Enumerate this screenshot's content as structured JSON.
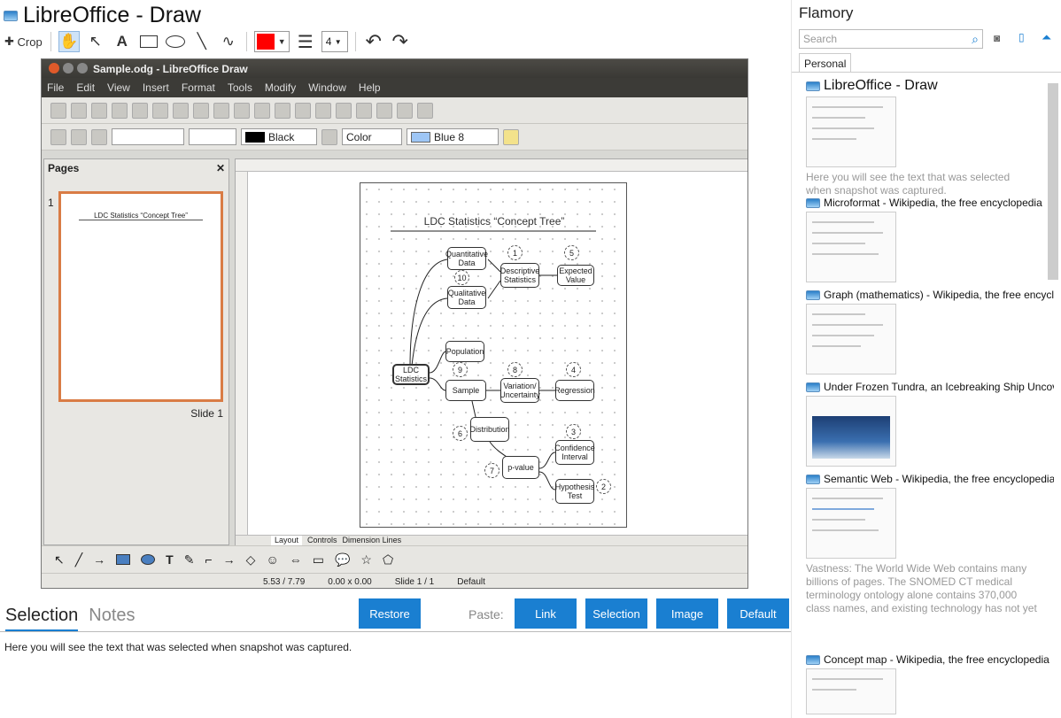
{
  "header": {
    "title": "LibreOffice - Draw",
    "crop_label": "Crop",
    "line_width": "4"
  },
  "lo": {
    "window_title": "Sample.odg - LibreOffice Draw",
    "menu": [
      "File",
      "Edit",
      "View",
      "Insert",
      "Format",
      "Tools",
      "Modify",
      "Window",
      "Help"
    ],
    "line_color": "Black",
    "fill_type": "Color",
    "fill_color": "Blue 8",
    "pages_title": "Pages",
    "page_number": "1",
    "slide_label": "Slide 1",
    "tabs": [
      "Layout",
      "Controls",
      "Dimension Lines"
    ],
    "status": {
      "position": "5.53 / 7.79",
      "size": "0.00 x 0.00",
      "slide": "Slide 1 / 1",
      "master": "Default"
    },
    "diagram": {
      "title": "LDC Statistics “Concept Tree”",
      "nodes": [
        "LDC Statistics",
        "Quantitative Data",
        "Qualitative Data",
        "Descriptive Statistics",
        "Expected Value",
        "Population",
        "Sample",
        "Variation/ Uncertainty",
        "Regression",
        "Distribution",
        "Confidence Interval",
        "p-value",
        "Hypothesis Test"
      ],
      "numbers": [
        "1",
        "5",
        "10",
        "9",
        "8",
        "4",
        "6",
        "3",
        "7",
        "2"
      ]
    }
  },
  "bottom": {
    "tab_selection": "Selection",
    "tab_notes": "Notes",
    "restore": "Restore",
    "paste_label": "Paste:",
    "paste_buttons": [
      "Link",
      "Selection",
      "Image",
      "Default"
    ],
    "selection_text": "Here you will see the text that was selected when snapshot was captured."
  },
  "side": {
    "app_name": "Flamory",
    "search_placeholder": "Search",
    "tab": "Personal",
    "items": [
      {
        "title": "LibreOffice - Draw",
        "desc": "Here you will see the text that was selected when snapshot was captured."
      },
      {
        "title": "Microformat - Wikipedia, the free encyclopedia"
      },
      {
        "title": "Graph (mathematics) - Wikipedia, the free encyclopedia"
      },
      {
        "title": "Under Frozen Tundra, an Icebreaking Ship Uncovers"
      },
      {
        "title": "Semantic Web - Wikipedia, the free encyclopedia",
        "desc": "Vastness: The World Wide Web contains many billions of pages. The SNOMED CT medical terminology ontology alone contains 370,000 class names, and existing technology has not yet been able to eliminate all semantically duplicated terms. Any automated reasoning system will have to deal with truly huge inputs."
      },
      {
        "title": "Concept map - Wikipedia, the free encyclopedia"
      }
    ]
  }
}
